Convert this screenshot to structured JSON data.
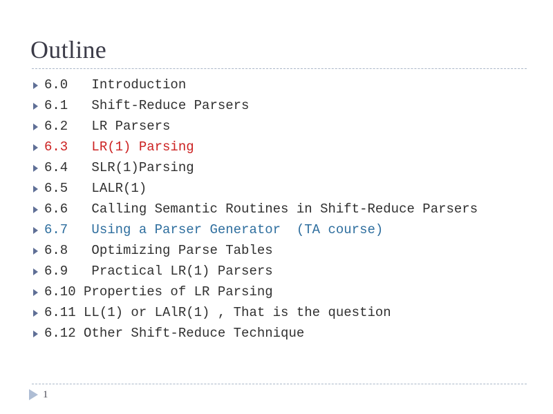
{
  "slide": {
    "title": "Outline",
    "page_number": "1",
    "colors": {
      "title": "#3b3b48",
      "body": "#303030",
      "accent_red": "#cc2222",
      "accent_blue": "#2e6e9e",
      "bullet": "#5f6f96",
      "rule": "#a9b6c8",
      "background": "#ffffff"
    },
    "bullet_icon": "triangle-right-icon",
    "footer_icon": "triangle-right-icon",
    "items": [
      {
        "text": "6.0   Introduction",
        "accent": "none"
      },
      {
        "text": "6.1   Shift-Reduce Parsers",
        "accent": "none"
      },
      {
        "text": "6.2   LR Parsers",
        "accent": "none"
      },
      {
        "text": "6.3   LR(1) Parsing",
        "accent": "red"
      },
      {
        "text": "6.4   SLR(1)Parsing",
        "accent": "none"
      },
      {
        "text": "6.5   LALR(1)",
        "accent": "none"
      },
      {
        "text": "6.6   Calling Semantic Routines in Shift-Reduce Parsers",
        "accent": "none"
      },
      {
        "text": "6.7   Using a Parser Generator  (TA course)",
        "accent": "blue"
      },
      {
        "text": "6.8   Optimizing Parse Tables",
        "accent": "none"
      },
      {
        "text": "6.9   Practical LR(1) Parsers",
        "accent": "none"
      },
      {
        "text": "6.10 Properties of LR Parsing",
        "accent": "none"
      },
      {
        "text": "6.11 LL(1) or LAlR(1) , That is the question",
        "accent": "none"
      },
      {
        "text": "6.12 Other Shift-Reduce Technique",
        "accent": "none"
      }
    ]
  }
}
